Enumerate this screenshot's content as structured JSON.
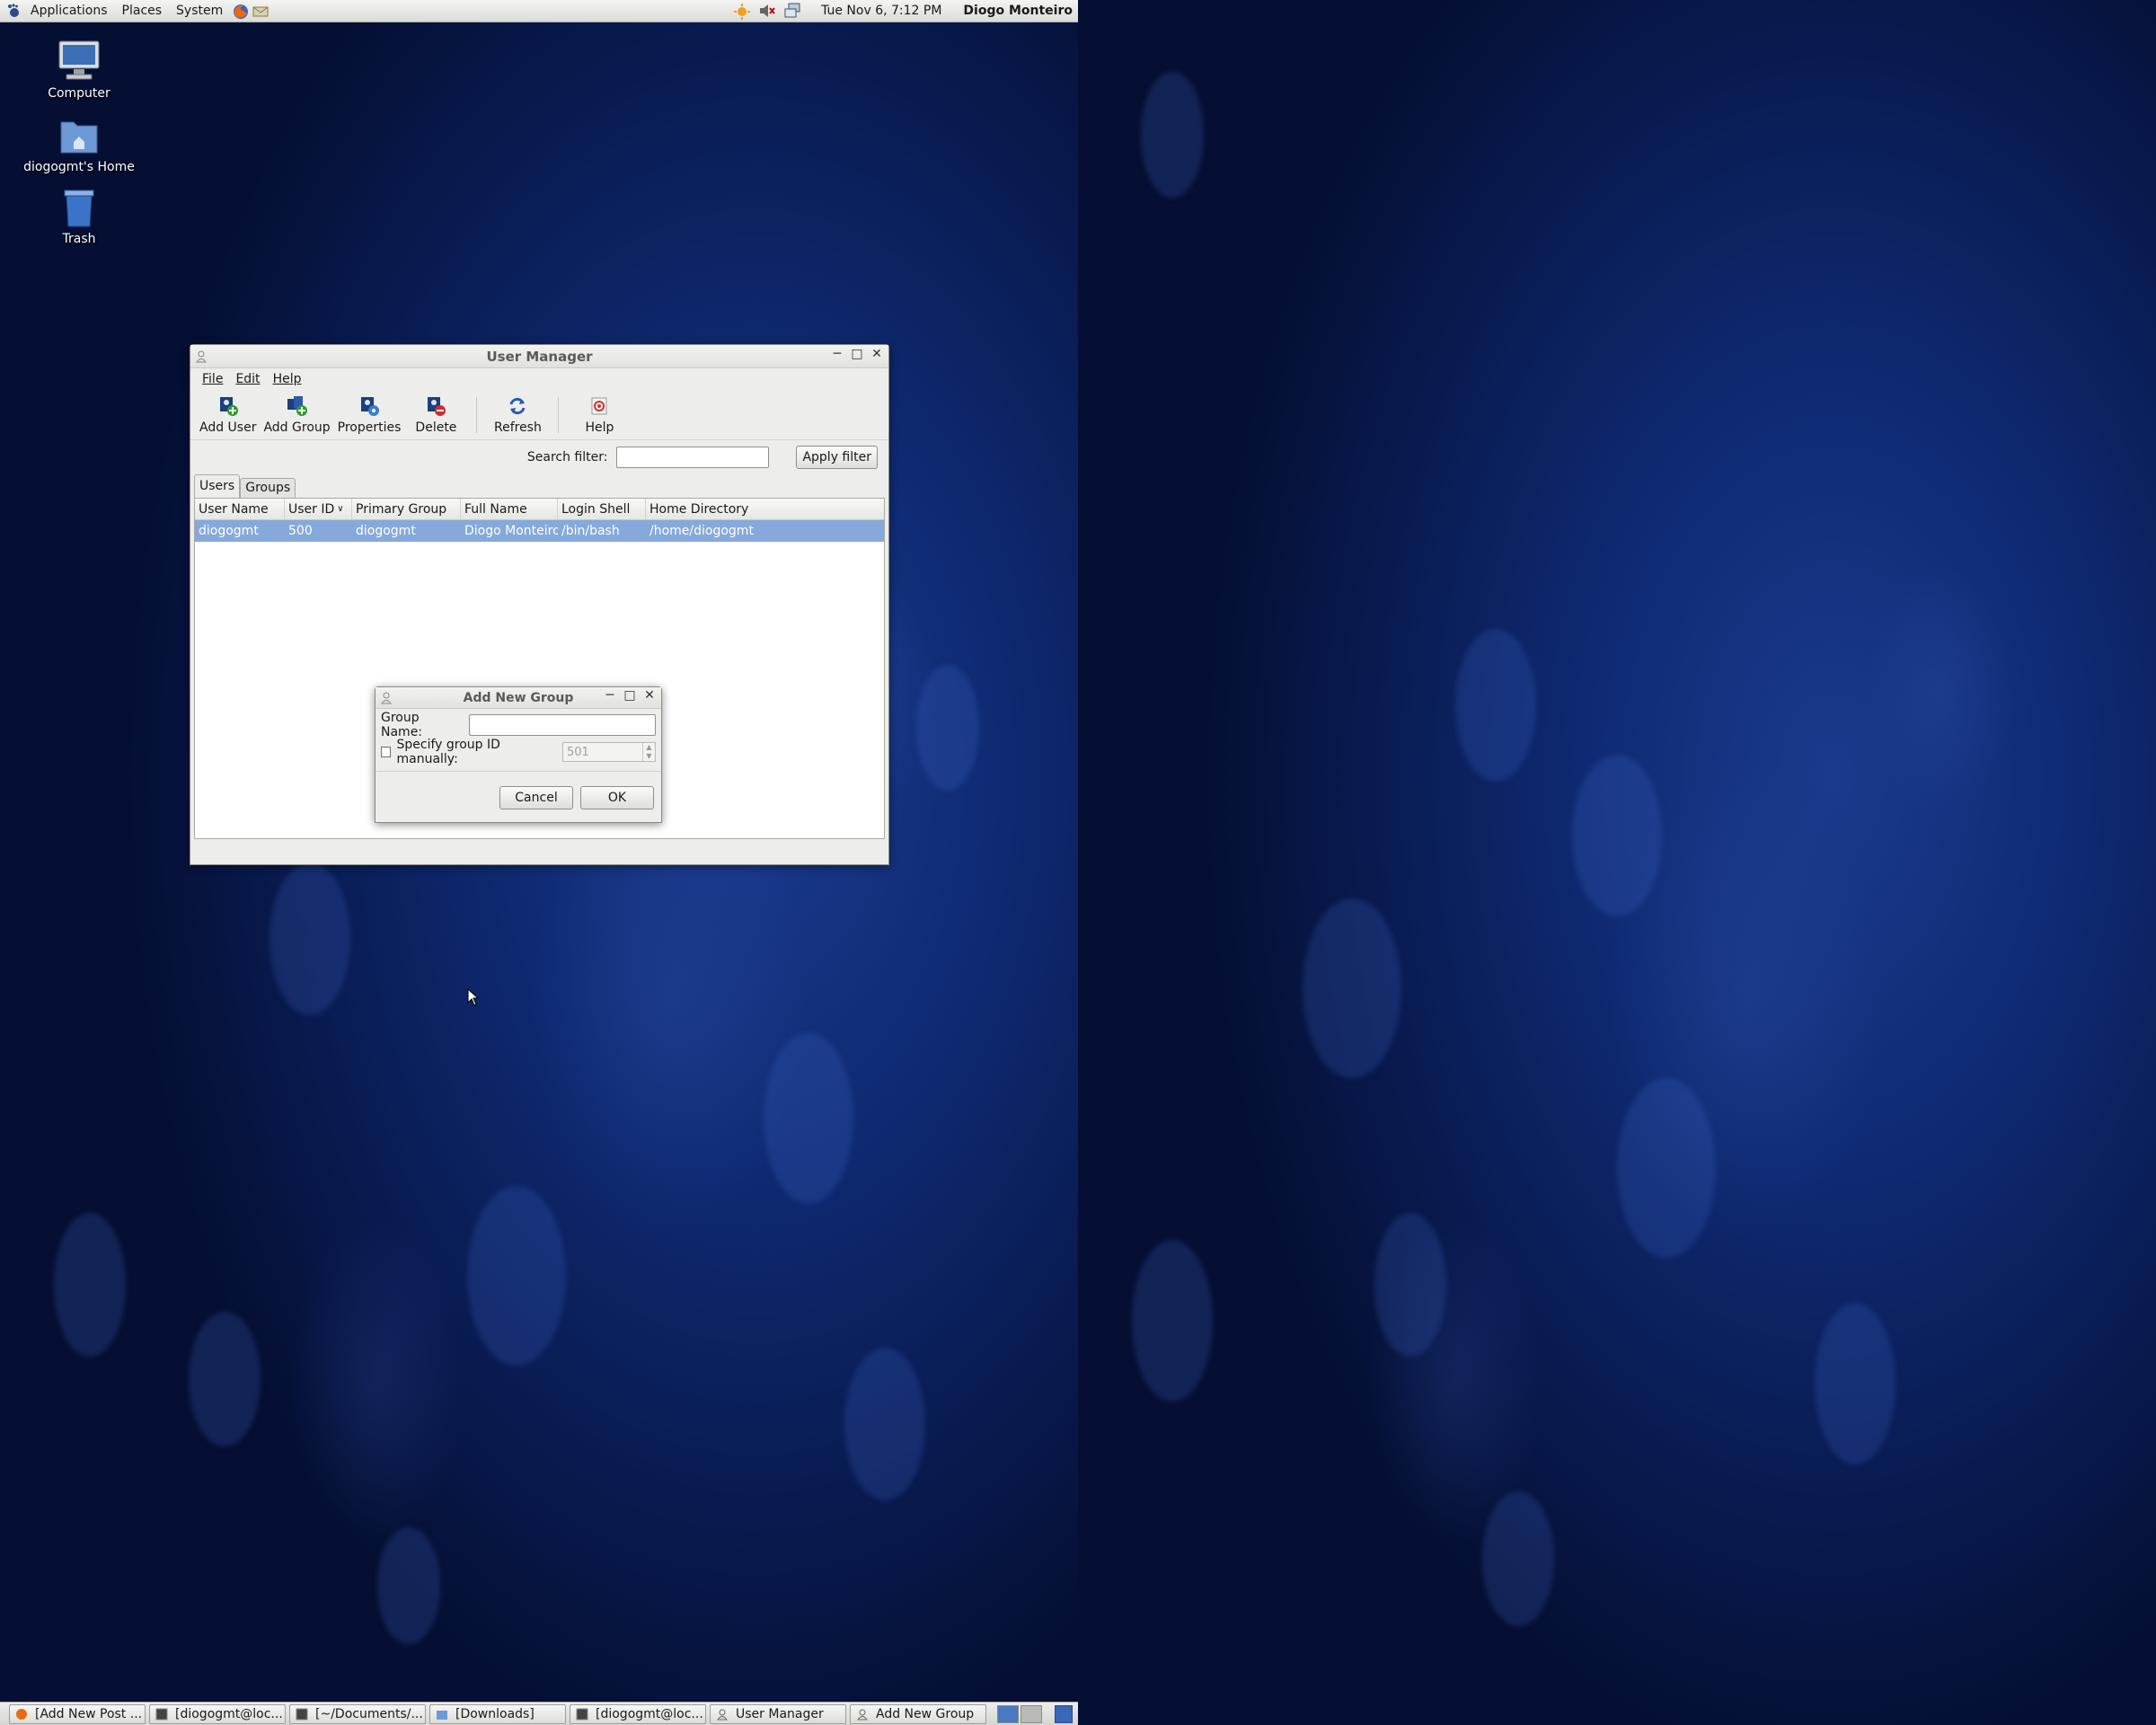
{
  "top_panel": {
    "menus": [
      "Applications",
      "Places",
      "System"
    ],
    "clock": "Tue Nov  6,  7:12 PM",
    "user": "Diogo Monteiro"
  },
  "desktop_icons": [
    {
      "label": "Computer"
    },
    {
      "label": "diogogmt's Home"
    },
    {
      "label": "Trash"
    }
  ],
  "user_manager": {
    "title": "User Manager",
    "menu": [
      "File",
      "Edit",
      "Help"
    ],
    "toolbar": [
      "Add User",
      "Add Group",
      "Properties",
      "Delete",
      "Refresh",
      "Help"
    ],
    "search_filter_label": "Search filter:",
    "search_filter_value": "",
    "apply_filter": "Apply filter",
    "tabs": [
      "Users",
      "Groups"
    ],
    "active_tab": "Users",
    "columns": [
      "User Name",
      "User ID",
      "Primary Group",
      "Full Name",
      "Login Shell",
      "Home Directory"
    ],
    "sorted_column": "User ID",
    "rows": [
      [
        "diogogmt",
        "500",
        "diogogmt",
        "Diogo Monteiro",
        "/bin/bash",
        "/home/diogogmt"
      ]
    ]
  },
  "add_group_dialog": {
    "title": "Add New Group",
    "group_name_label": "Group Name:",
    "group_name_value": "",
    "specify_gid_label": "Specify group ID manually:",
    "specify_gid_checked": false,
    "gid_value": "501",
    "cancel": "Cancel",
    "ok": "OK"
  },
  "taskbar": {
    "tasks": [
      "[Add New Post ...",
      "[diogogmt@loc...",
      "[~/Documents/...",
      "[Downloads]",
      "[diogogmt@loc...",
      "User Manager",
      "Add New Group"
    ]
  },
  "colors": {
    "selection": "#86a9db",
    "desktop": "#0f2a72"
  }
}
